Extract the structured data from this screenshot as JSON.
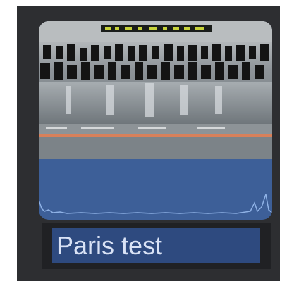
{
  "clip": {
    "name": "Paris test",
    "waveform_color": "#3d5f98",
    "name_field_color": "#2e4a7f",
    "thumbnail_icon": "mixing-console-photo"
  }
}
